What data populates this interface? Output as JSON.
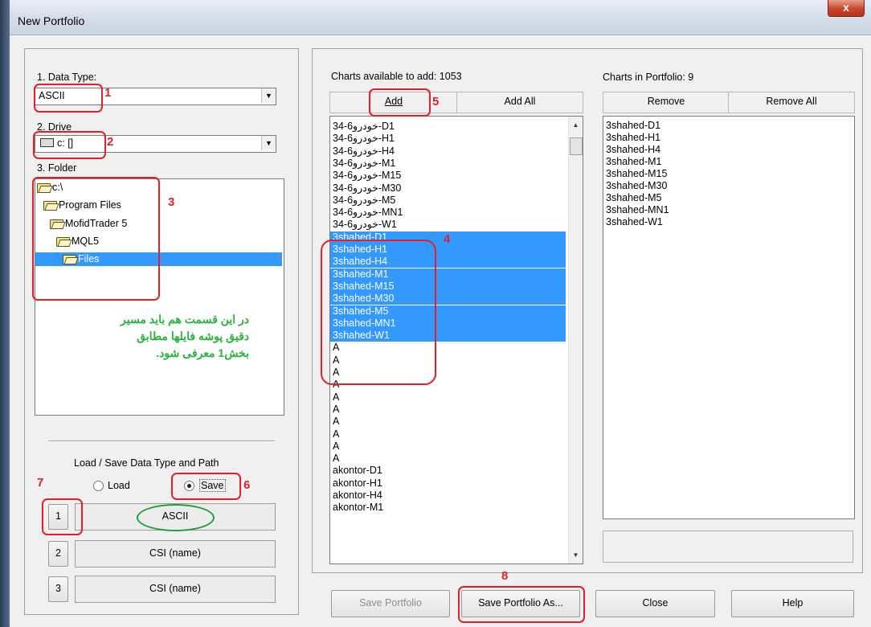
{
  "window": {
    "title": "New Portfolio",
    "close_glyph": "x"
  },
  "left_panel": {
    "data_type": {
      "label": "1. Data Type:",
      "value": "ASCII"
    },
    "drive": {
      "label": "2. Drive",
      "value": "c: []"
    },
    "folder": {
      "label": "3. Folder",
      "items": [
        {
          "label": "c:\\"
        },
        {
          "label": "Program Files"
        },
        {
          "label": "MofidTrader 5"
        },
        {
          "label": "MQL5"
        },
        {
          "label": "Files",
          "selected": true
        }
      ]
    },
    "persian_note": [
      "در این قسمت هم باید مسیر",
      "دقیق پوشه فایلها مطابق",
      "بخش1 معرفی شود."
    ],
    "load_save": {
      "title": "Load / Save Data Type and Path",
      "load_label": "Load",
      "save_label": "Save",
      "selected": "Save"
    },
    "slots": [
      {
        "button": "1",
        "value": "ASCII"
      },
      {
        "button": "2",
        "value": "CSI (name)"
      },
      {
        "button": "3",
        "value": "CSI (name)"
      }
    ]
  },
  "available": {
    "header": "Charts available to add: 1053",
    "add_label": "Add",
    "add_all_label": "Add All",
    "items": [
      "34-6خودرو-D1",
      "34-6خودرو-H1",
      "34-6خودرو-H4",
      "34-6خودرو-M1",
      "34-6خودرو-M15",
      "34-6خودرو-M30",
      "34-6خودرو-M5",
      "34-6خودرو-MN1",
      "34-6خودرو-W1",
      "3shahed-D1",
      "3shahed-H1",
      "3shahed-H4",
      "3shahed-M1",
      "3shahed-M15",
      "3shahed-M30",
      "3shahed-M5",
      "3shahed-MN1",
      "3shahed-W1",
      "A",
      "A",
      "A",
      "A",
      "A",
      "A",
      "A",
      "A",
      "A",
      "A",
      "akontor-D1",
      "akontor-H1",
      "akontor-H4",
      "akontor-M1"
    ]
  },
  "portfolio": {
    "header": "Charts in Portfolio: 9",
    "remove_label": "Remove",
    "remove_all_label": "Remove All",
    "items": [
      "3shahed-D1",
      "3shahed-H1",
      "3shahed-H4",
      "3shahed-M1",
      "3shahed-M15",
      "3shahed-M30",
      "3shahed-M5",
      "3shahed-MN1",
      "3shahed-W1"
    ]
  },
  "bottom_buttons": {
    "save_portfolio": "Save Portfolio",
    "save_portfolio_as": "Save Portfolio As...",
    "close": "Close",
    "help": "Help"
  },
  "annotations": [
    "1",
    "2",
    "3",
    "4",
    "5",
    "6",
    "7",
    "8"
  ],
  "colors": {
    "annotation_red": "#e0212b",
    "annotation_green": "#1f9e3d",
    "selection_blue": "#3399ff",
    "note_green": "#27b43b"
  }
}
